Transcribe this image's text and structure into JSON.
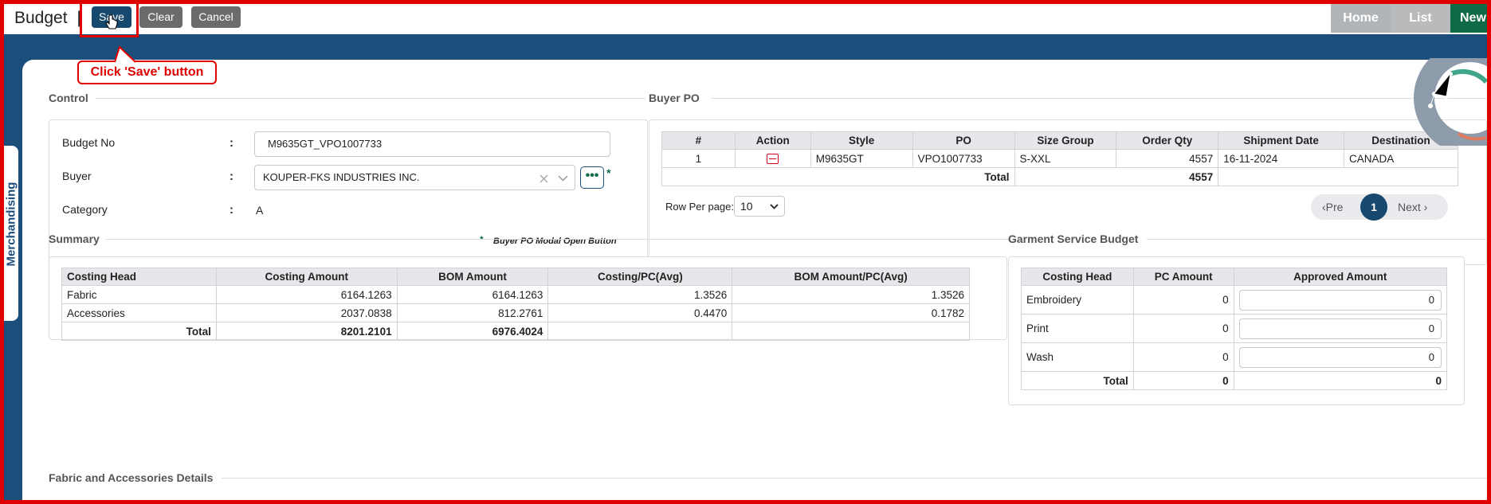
{
  "header": {
    "title": "Budget",
    "separator": "|",
    "buttons": {
      "save": "Save",
      "clear": "Clear",
      "cancel": "Cancel"
    },
    "breadcrumbs": [
      "Home",
      "List",
      "New"
    ]
  },
  "callout": "Click 'Save' button",
  "sidetab": "Merchandising",
  "control": {
    "legend": "Control",
    "budget_no_label": "Budget No",
    "budget_no_value": "M9635GT_VPO1007733",
    "buyer_label": "Buyer",
    "buyer_value": "KOUPER-FKS INDUSTRIES INC.",
    "category_label": "Category",
    "category_value": "A",
    "colon": ":",
    "dots": "•••",
    "star": "*",
    "note": "Buyer PO Modal Open Button"
  },
  "buyer_po": {
    "legend": "Buyer PO",
    "columns": [
      "#",
      "Action",
      "Style",
      "PO",
      "Size Group",
      "Order Qty",
      "Shipment Date",
      "Destination"
    ],
    "rows": [
      {
        "no": "1",
        "style": "M9635GT",
        "po": "VPO1007733",
        "size_group": "S-XXL",
        "order_qty": "4557",
        "shipment_date": "16-11-2024",
        "destination": "CANADA"
      }
    ],
    "total_label": "Total",
    "total_qty": "4557",
    "rows_per_page_label": "Row Per page:",
    "rows_per_page": "10",
    "pager": {
      "prev": "‹Pre",
      "current": "1",
      "next": "Next ›"
    }
  },
  "summary": {
    "legend": "Summary",
    "columns": [
      "Costing Head",
      "Costing Amount",
      "BOM Amount",
      "Costing/PC(Avg)",
      "BOM Amount/PC(Avg)"
    ],
    "rows": [
      {
        "head": "Fabric",
        "costing": "6164.1263",
        "bom": "6164.1263",
        "costing_pc": "1.3526",
        "bom_pc": "1.3526"
      },
      {
        "head": "Accessories",
        "costing": "2037.0838",
        "bom": "812.2761",
        "costing_pc": "0.4470",
        "bom_pc": "0.1782"
      }
    ],
    "total_label": "Total",
    "total_costing": "8201.2101",
    "total_bom": "6976.4024"
  },
  "garment": {
    "legend": "Garment Service Budget",
    "columns": [
      "Costing Head",
      "PC Amount",
      "Approved Amount"
    ],
    "rows": [
      {
        "head": "Embroidery",
        "pc": "0",
        "approved": "0"
      },
      {
        "head": "Print",
        "pc": "0",
        "approved": "0"
      },
      {
        "head": "Wash",
        "pc": "0",
        "approved": "0"
      }
    ],
    "total_label": "Total",
    "total_pc": "0",
    "total_approved": "0"
  },
  "fabric_details": {
    "legend": "Fabric and Accessories Details"
  },
  "colors": {
    "primary": "#17486e",
    "band": "#1b4e7a",
    "accent_green": "#0e6b46",
    "highlight": "#e00000"
  }
}
